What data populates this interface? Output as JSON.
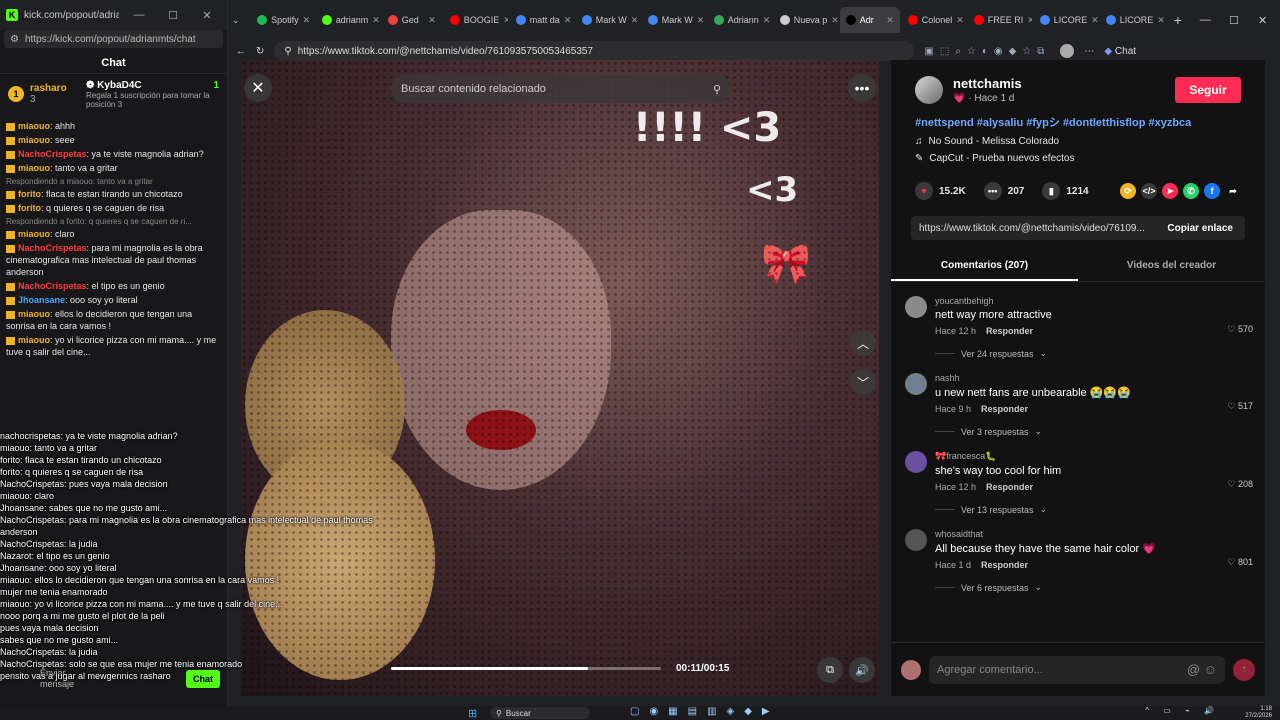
{
  "chat_window": {
    "title": "kick.com/popout/adrianmts...",
    "url": "https://kick.com/popout/adrianmts/chat",
    "header": "Chat",
    "podium": {
      "first": {
        "user": "rasharo",
        "count": "3"
      },
      "second": {
        "user": "KybaD4C",
        "count": "1",
        "note": "Regala 1 suscripción para tomar la posición 3"
      }
    },
    "messages": [
      {
        "user": "miaouo",
        "text": "ahhh",
        "color": "#f0b429"
      },
      {
        "user": "miaouo",
        "text": "seee",
        "color": "#f0b429"
      },
      {
        "user": "NachoCrispetas",
        "text": "ya te viste magnolia adrian?",
        "color": "#ff3b3b"
      },
      {
        "user": "miaouo",
        "text": "tanto va a gritar",
        "color": "#f0b429"
      },
      {
        "reply": "Respondiendo a miaouo: tanto va a gritar",
        "user": "forito",
        "text": "flaca te estan tirando un chicotazo",
        "color": "#f0b429"
      },
      {
        "user": "forito",
        "text": "q quieres q se caguen de risa",
        "color": "#f0b429"
      },
      {
        "reply": "Respondiendo a forito: q quieres q se caguen de ri...",
        "user": "miaouo",
        "text": "claro",
        "color": "#f0b429"
      },
      {
        "user": "NachoCrispetas",
        "text": "para mi magnolia es la obra cinematografica mas intelectual de paul thomas anderson",
        "color": "#ff3b3b"
      },
      {
        "user": "NachoCrispetas",
        "text": "el tipo es un genio",
        "color": "#ff3b3b"
      },
      {
        "user": "Jhoansane",
        "text": "ooo soy yo literal",
        "color": "#4aa3ff"
      },
      {
        "user": "miaouo",
        "text": "ellos lo decidieron que tengan una sonrisa en la cara vamos !",
        "color": "#f0b429"
      },
      {
        "user": "miaouo",
        "text": "yo vi licorice pizza con mi mama.... y me tuve q salir del cine...",
        "color": "#f0b429"
      }
    ],
    "overlay_lines": [
      "nachocrispetas: ya te viste magnolia adrian?",
      "miaouo: tanto va a gritar",
      "forito: flaca te estan tirando un chicotazo",
      "forito: q quieres q se caguen de risa",
      "NachoCrispetas: pues vaya mala decision",
      "miaouo: claro",
      "Jhoansane: sabes que no me gusto ami...",
      "NachoCrispetas: para mi magnolia es la obra cinematografica mas intelectual de paul thomas anderson",
      "NachoCrispetas: la judia",
      "Nazarot: el tipo es un genio",
      "Jhoansane: ooo soy yo literal",
      "miaouo: ellos lo decidieron que tengan una sonrisa en la cara vamos !",
      "mujer me tenia enamorado",
      "miaouo: yo vi licorice pizza con mi mama.... y me tuve q salir del cine...",
      "nooo porq a mi me gusto el plot de la peli",
      "pues vaya mala decision",
      "sabes que no me gusto ami...",
      "NachoCrispetas: la judia",
      "NachoCrispetas: solo se que esa mujer me tenia enamorado",
      "pensito vas a jugar al mewgennics rasharo"
    ],
    "send_label": "Chat",
    "send_hint": "Enviar mensaje"
  },
  "browser": {
    "tabs": [
      {
        "label": "Spotify",
        "color": "#1db954"
      },
      {
        "label": "adrianm",
        "color": "#53fc18"
      },
      {
        "label": "Ged",
        "color": "#ea4335"
      },
      {
        "label": "BOOGIE",
        "color": "#ff0000"
      },
      {
        "label": "matt da",
        "color": "#4285f4"
      },
      {
        "label": "Mark W",
        "color": "#4285f4"
      },
      {
        "label": "Mark W",
        "color": "#4285f4"
      },
      {
        "label": "Adriann",
        "color": "#34a853"
      },
      {
        "label": "Nueva p",
        "color": "#cccccc"
      },
      {
        "label": "Adr",
        "color": "#000000",
        "active": true
      },
      {
        "label": "Colonel",
        "color": "#ff0000"
      },
      {
        "label": "FREE RI",
        "color": "#ff0000"
      },
      {
        "label": "LICORE",
        "color": "#4285f4"
      },
      {
        "label": "LICORE",
        "color": "#4285f4"
      }
    ],
    "url": "https://www.tiktok.com/@nettchamis/video/7610935750053465357",
    "chat_label": "Chat"
  },
  "video": {
    "search_placeholder": "Buscar contenido relacionado",
    "overlay_text_1": "!!!! <3",
    "overlay_text_2": "<3",
    "time": "00:11/00:15",
    "progress": 0.73
  },
  "post": {
    "author": "nettchamis",
    "subtitle": "· Hace 1 d",
    "follow_label": "Seguir",
    "hashtags": "#nettspend #alysaliu #fypシ #dontletthisflop #xyzbca",
    "sound": "No Sound - Melissa Colorado",
    "effect": "CapCut - Prueba nuevos efectos",
    "likes": "15.2K",
    "comments": "207",
    "saves": "1214",
    "link": "https://www.tiktok.com/@nettchamis/video/76109...",
    "copy_label": "Copiar enlace",
    "tab_comments": "Comentarios (207)",
    "tab_creator": "Videos del creador"
  },
  "comments": [
    {
      "user": "youcantbehigh",
      "text": "nett way more attractive",
      "time": "Hace 12 h",
      "reply": "Responder",
      "likes": "570",
      "more": "Ver 24 respuestas"
    },
    {
      "user": "nashh",
      "text": "u new nett fans are unbearable 😭😭😭",
      "time": "Hace 9 h",
      "reply": "Responder",
      "likes": "517",
      "more": "Ver 3 respuestas"
    },
    {
      "user": "🎀francesca🐛",
      "text": "she's way too cool for him",
      "time": "Hace 12 h",
      "reply": "Responder",
      "likes": "208",
      "more": "Ver 13 respuestas"
    },
    {
      "user": "whosaidthat",
      "text": "All because they have the same hair color 💗",
      "time": "Hace 1 d",
      "reply": "Responder",
      "likes": "801",
      "more": "Ver 6 respuestas"
    }
  ],
  "add_comment_placeholder": "Agregar comentario...",
  "taskbar": {
    "search": "Buscar",
    "time": "1:18",
    "date": "27/2/2026"
  }
}
